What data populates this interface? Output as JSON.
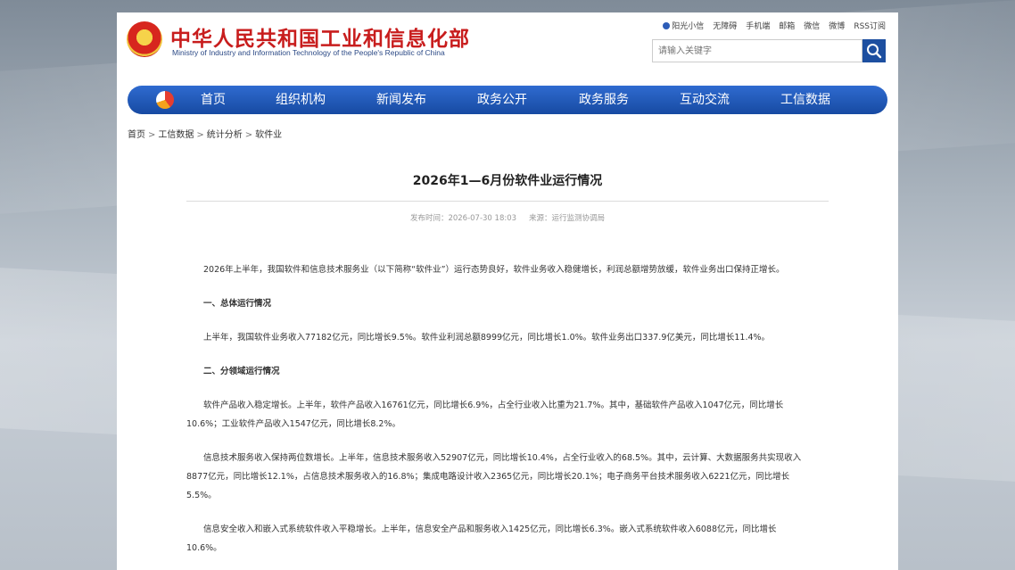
{
  "header": {
    "title": "中华人民共和国工业和信息化部",
    "subtitle": "Ministry of Industry and Information Technology of the People's Republic of China",
    "top_links": [
      "阳光小信",
      "无障碍",
      "手机端",
      "邮箱",
      "微信",
      "微博",
      "RSS订阅"
    ],
    "search_placeholder": "请输入关键字"
  },
  "nav": {
    "items": [
      "首页",
      "组织机构",
      "新闻发布",
      "政务公开",
      "政务服务",
      "互动交流",
      "工信数据"
    ]
  },
  "breadcrumb": [
    "首页",
    "工信数据",
    "统计分析",
    "软件业"
  ],
  "article": {
    "title": "2026年1—6月份软件业运行情况",
    "publish_label": "发布时间：2026-07-30 18:03",
    "source_label": "来源：运行监测协调局",
    "intro": "2026年上半年，我国软件和信息技术服务业（以下简称“软件业”）运行态势良好，软件业务收入稳健增长，利润总额增势放缓，软件业务出口保持正增长。",
    "section1_heading": "一、总体运行情况",
    "section1_p1": "上半年，我国软件业务收入77182亿元，同比增长9.5%。软件业利润总额8999亿元，同比增长1.0%。软件业务出口337.9亿美元，同比增长11.4%。",
    "section2_heading": "二、分领域运行情况",
    "section2_p1": "软件产品收入稳定增长。上半年，软件产品收入16761亿元，同比增长6.9%，占全行业收入比重为21.7%。其中，基础软件产品收入1047亿元，同比增长10.6%；工业软件产品收入1547亿元，同比增长8.2%。",
    "section2_p2": "信息技术服务收入保持两位数增长。上半年，信息技术服务收入52907亿元，同比增长10.4%，占全行业收入的68.5%。其中，云计算、大数据服务共实现收入8877亿元，同比增长12.1%，占信息技术服务收入的16.8%；集成电路设计收入2365亿元，同比增长20.1%；电子商务平台技术服务收入6221亿元，同比增长5.5%。",
    "section2_p3": "信息安全收入和嵌入式系统软件收入平稳增长。上半年，信息安全产品和服务收入1425亿元，同比增长6.3%。嵌入式系统软件收入6088亿元，同比增长10.6%。"
  }
}
